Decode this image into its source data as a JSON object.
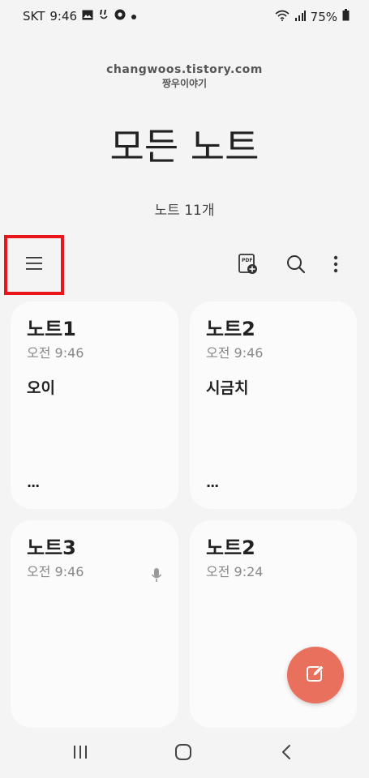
{
  "status": {
    "carrier": "SKT",
    "time": "9:46",
    "battery": "75%",
    "icons_left": [
      "gallery-icon",
      "hangouts-icon",
      "chrome-icon",
      "dot-icon"
    ],
    "icons_right": [
      "wifi-icon",
      "signal-icon",
      "battery-icon"
    ]
  },
  "watermark": {
    "url": "changwoos.tistory.com",
    "name": "짱우이야기"
  },
  "header": {
    "title": "모든 노트",
    "count": "노트 11개"
  },
  "toolbar": {
    "menu_icon": "hamburger-icon",
    "pdf_icon": "pdf-import-icon",
    "search_icon": "search-icon",
    "more_icon": "more-vert-icon",
    "pdf_label": "PDF"
  },
  "notes": [
    {
      "title": "노트1",
      "time": "오전 9:46",
      "body": "오이",
      "more": "..."
    },
    {
      "title": "노트2",
      "time": "오전 9:46",
      "body": "시금치",
      "more": "..."
    },
    {
      "title": "노트3",
      "time": "오전 9:46",
      "body": "",
      "more": ""
    },
    {
      "title": "노트2",
      "time": "오전 9:24",
      "body": "",
      "more": ""
    }
  ],
  "colors": {
    "background": "#f4f4f4",
    "card": "#fbfbfb",
    "fab": "#e8705c",
    "highlight": "#e8151b"
  },
  "fab": {
    "icon": "compose-icon"
  },
  "navbar": {
    "icons": [
      "recent-apps-icon",
      "home-icon",
      "back-icon"
    ]
  }
}
